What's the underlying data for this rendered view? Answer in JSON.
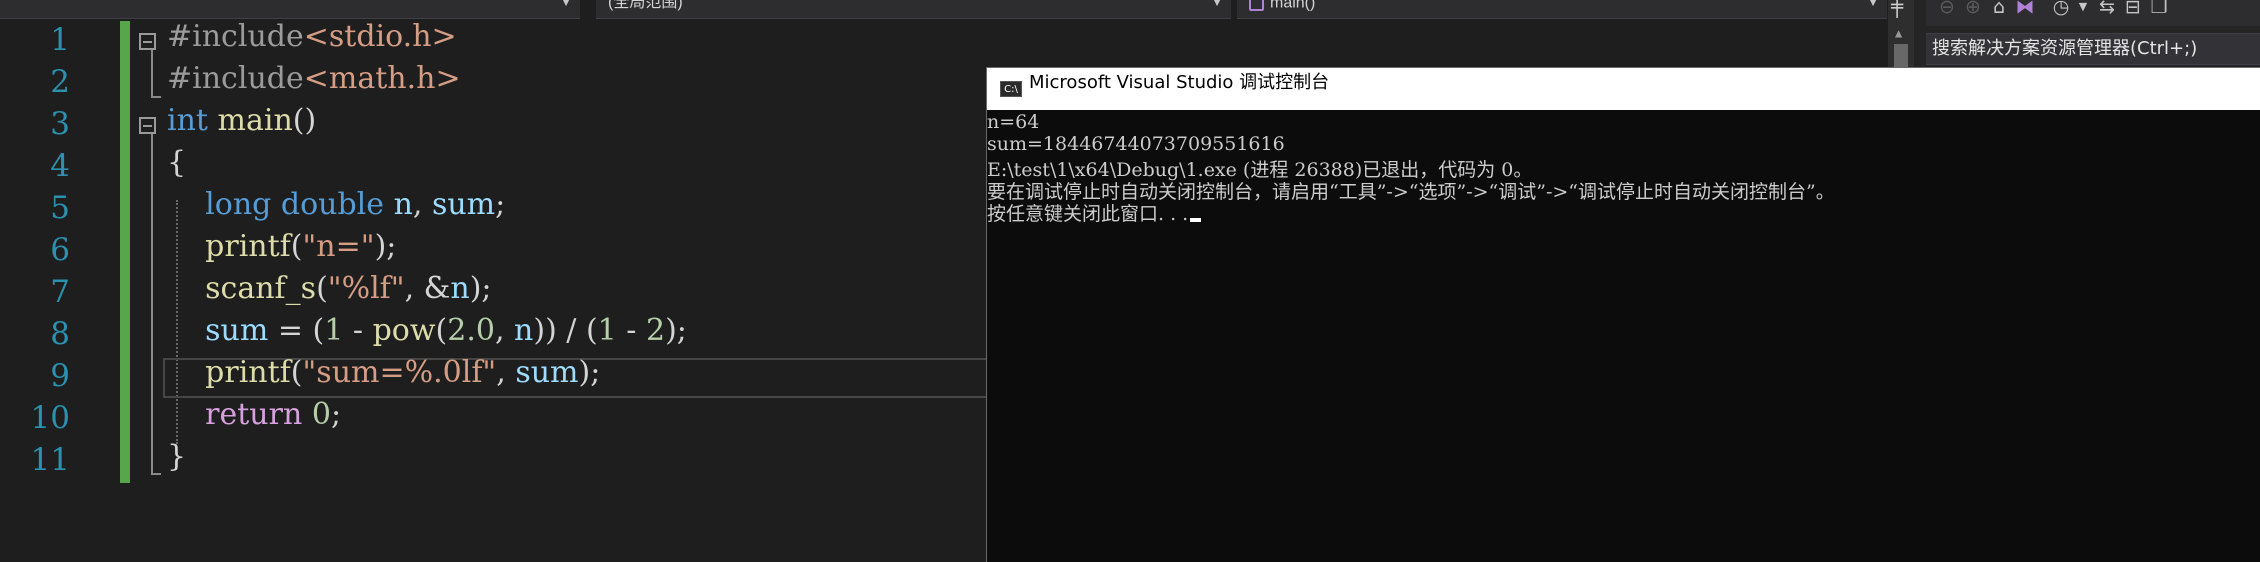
{
  "nav": {
    "scope_label": "(全局范围)",
    "member_label": "main()"
  },
  "editor": {
    "line_numbers": [
      "1",
      "2",
      "3",
      "4",
      "5",
      "6",
      "7",
      "8",
      "9",
      "10",
      "11"
    ],
    "lines": [
      [
        {
          "c": "pre",
          "t": "#include"
        },
        {
          "c": "inc",
          "t": "<stdio.h>"
        }
      ],
      [
        {
          "c": "pre",
          "t": "#include"
        },
        {
          "c": "inc",
          "t": "<math.h>"
        }
      ],
      [
        {
          "c": "kw",
          "t": "int"
        },
        {
          "c": "op",
          "t": " "
        },
        {
          "c": "fn",
          "t": "main"
        },
        {
          "c": "op",
          "t": "()"
        }
      ],
      [
        {
          "c": "op",
          "t": "{"
        }
      ],
      [
        {
          "c": "op",
          "t": "    "
        },
        {
          "c": "kw",
          "t": "long double"
        },
        {
          "c": "op",
          "t": " "
        },
        {
          "c": "var",
          "t": "n"
        },
        {
          "c": "op",
          "t": ", "
        },
        {
          "c": "var",
          "t": "sum"
        },
        {
          "c": "op",
          "t": ";"
        }
      ],
      [
        {
          "c": "op",
          "t": "    "
        },
        {
          "c": "fn",
          "t": "printf"
        },
        {
          "c": "op",
          "t": "("
        },
        {
          "c": "str",
          "t": "\"n=\""
        },
        {
          "c": "op",
          "t": ");"
        }
      ],
      [
        {
          "c": "op",
          "t": "    "
        },
        {
          "c": "fn",
          "t": "scanf_s"
        },
        {
          "c": "op",
          "t": "("
        },
        {
          "c": "str",
          "t": "\"%lf\""
        },
        {
          "c": "op",
          "t": ", &"
        },
        {
          "c": "var",
          "t": "n"
        },
        {
          "c": "op",
          "t": ");"
        }
      ],
      [
        {
          "c": "op",
          "t": "    "
        },
        {
          "c": "var",
          "t": "sum"
        },
        {
          "c": "op",
          "t": " = ("
        },
        {
          "c": "num",
          "t": "1"
        },
        {
          "c": "op",
          "t": " - "
        },
        {
          "c": "fn",
          "t": "pow"
        },
        {
          "c": "op",
          "t": "("
        },
        {
          "c": "num",
          "t": "2.0"
        },
        {
          "c": "op",
          "t": ", "
        },
        {
          "c": "var",
          "t": "n"
        },
        {
          "c": "op",
          "t": ")) / ("
        },
        {
          "c": "num",
          "t": "1"
        },
        {
          "c": "op",
          "t": " - "
        },
        {
          "c": "num",
          "t": "2"
        },
        {
          "c": "op",
          "t": ");"
        }
      ],
      [
        {
          "c": "op",
          "t": "    "
        },
        {
          "c": "fn",
          "t": "printf"
        },
        {
          "c": "op",
          "t": "("
        },
        {
          "c": "str",
          "t": "\"sum=%.0lf\""
        },
        {
          "c": "op",
          "t": ", "
        },
        {
          "c": "var",
          "t": "sum"
        },
        {
          "c": "op",
          "t": ");"
        }
      ],
      [
        {
          "c": "op",
          "t": "    "
        },
        {
          "c": "ctl",
          "t": "return"
        },
        {
          "c": "op",
          "t": " "
        },
        {
          "c": "num",
          "t": "0"
        },
        {
          "c": "op",
          "t": ";"
        }
      ],
      [
        {
          "c": "op",
          "t": "}"
        }
      ]
    ]
  },
  "console": {
    "title": "Microsoft Visual Studio 调试控制台",
    "icon_text": "C:\\",
    "output": [
      "n=64",
      "sum=18446744073709551616",
      "E:\\test\\1\\x64\\Debug\\1.exe (进程 26388)已退出，代码为 0。",
      "要在调试停止时自动关闭控制台，请启用“工具”->“选项”->“调试”->“调试停止时自动关闭控制台”。",
      "按任意键关闭此窗口. . ."
    ]
  },
  "solution_explorer": {
    "search_placeholder": "搜索解决方案资源管理器(Ctrl+;)"
  },
  "toolbar_icons": [
    "back-icon",
    "forward-icon",
    "home-icon",
    "vs-switch-icon",
    "history-icon",
    "dropdown-icon",
    "sync-icon",
    "collapse-icon",
    "copy-icon"
  ],
  "colors": {
    "editor_bg": "#1e1e1e",
    "line_number": "#2b91af",
    "keyword": "#569cd6",
    "function": "#dcdcaa",
    "variable": "#9cdcfe",
    "string": "#d69d85",
    "number": "#b5cea8",
    "control": "#d8a0df",
    "change_bar": "#57a64a",
    "console_bg": "#0c0c0c"
  }
}
